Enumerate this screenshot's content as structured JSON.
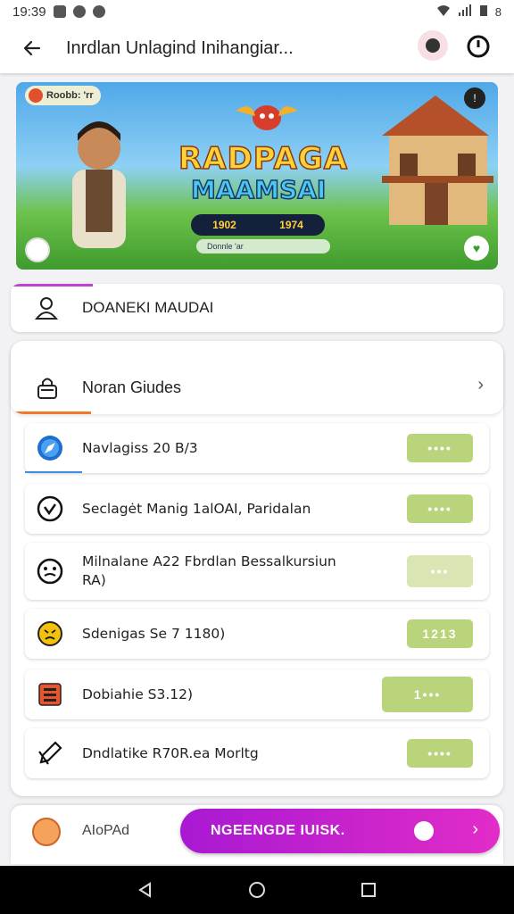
{
  "status_bar": {
    "time": "19:39",
    "right_text": "8"
  },
  "app_bar": {
    "title": "Inrdlan Unlagind Inihangiar..."
  },
  "banner": {
    "badge": "Roobb: 'rr",
    "title_line1": "RADPAGA",
    "title_line2": "MAAMSAI",
    "stat_left": "1902",
    "stat_right": "1974",
    "subtitle": "Donnle 'ar"
  },
  "account": {
    "label": "DOANEKI MAUDAI"
  },
  "panel": {
    "header_label": "Noran Giudes",
    "rows": [
      {
        "label": "Navlagiss 20 B/3",
        "pill": "••••",
        "icon": "compass-icon"
      },
      {
        "label": "Seclagėt Manig 1alOAI, Paridalan",
        "pill": "••••",
        "icon": "clock-icon"
      },
      {
        "label": "Milnalane A22 Fbrdlan Bessalkursiun RA)",
        "pill": "•••",
        "icon": "face-icon"
      },
      {
        "label": "Sdenigas Se 7 1180)",
        "pill": "1213",
        "icon": "emoji-icon"
      },
      {
        "label": "Dobiahie S3.12)",
        "pill": "1•••",
        "icon": "book-icon"
      },
      {
        "label": "Dndlatike R70R.ea Morltg",
        "pill": "••••",
        "icon": "edit-icon"
      }
    ]
  },
  "bottom": {
    "label": "AIoPAd",
    "cta_label": "NGEENGDE IUISK."
  },
  "colors": {
    "accent": "#c23fd8",
    "pill": "#b9d47a",
    "cta_start": "#a819d2",
    "cta_end": "#e22cc8"
  }
}
